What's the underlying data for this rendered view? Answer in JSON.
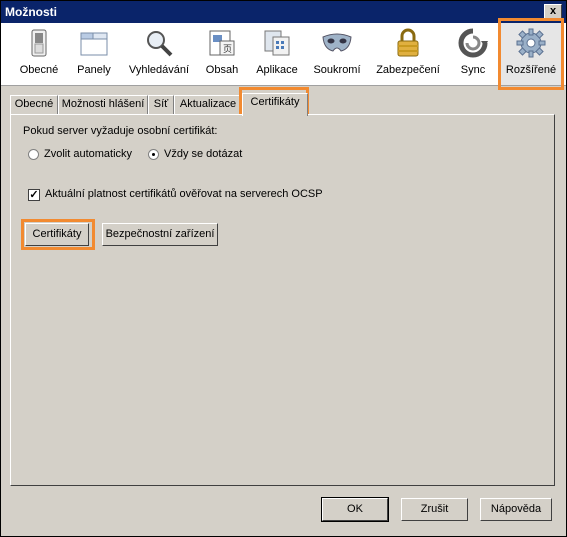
{
  "window": {
    "title": "Možnosti",
    "close_label": "x"
  },
  "toolbar": {
    "items": [
      {
        "label": "Obecné",
        "icon": "switch-icon"
      },
      {
        "label": "Panely",
        "icon": "window-tabs-icon"
      },
      {
        "label": "Vyhledávání",
        "icon": "magnifier-icon"
      },
      {
        "label": "Obsah",
        "icon": "content-page-icon"
      },
      {
        "label": "Aplikace",
        "icon": "applications-icon"
      },
      {
        "label": "Soukromí",
        "icon": "mask-icon"
      },
      {
        "label": "Zabezpečení",
        "icon": "padlock-icon"
      },
      {
        "label": "Sync",
        "icon": "sync-icon"
      },
      {
        "label": "Rozšířené",
        "icon": "gear-icon"
      }
    ],
    "selected": "Rozšířené",
    "highlight_color": "#f28a30"
  },
  "tabs": [
    "Obecné",
    "Možnosti hlášení",
    "Síť",
    "Aktualizace",
    "Certifikáty"
  ],
  "active_tab": "Certifikáty",
  "panel": {
    "question": "Pokud server vyžaduje osobní certifikát:",
    "radio_auto": "Zvolit automaticky",
    "radio_ask": "Vždy se dotázat",
    "radio_selected": "Vždy se dotázat",
    "ocsp_checkbox": "Aktuální platnost certifikátů ověřovat na serverech OCSP",
    "ocsp_checked": true,
    "certificates_button": "Certifikáty",
    "security_devices_button": "Bezpečnostní zařízení"
  },
  "buttons": {
    "ok": "OK",
    "cancel": "Zrušit",
    "help": "Nápověda"
  }
}
